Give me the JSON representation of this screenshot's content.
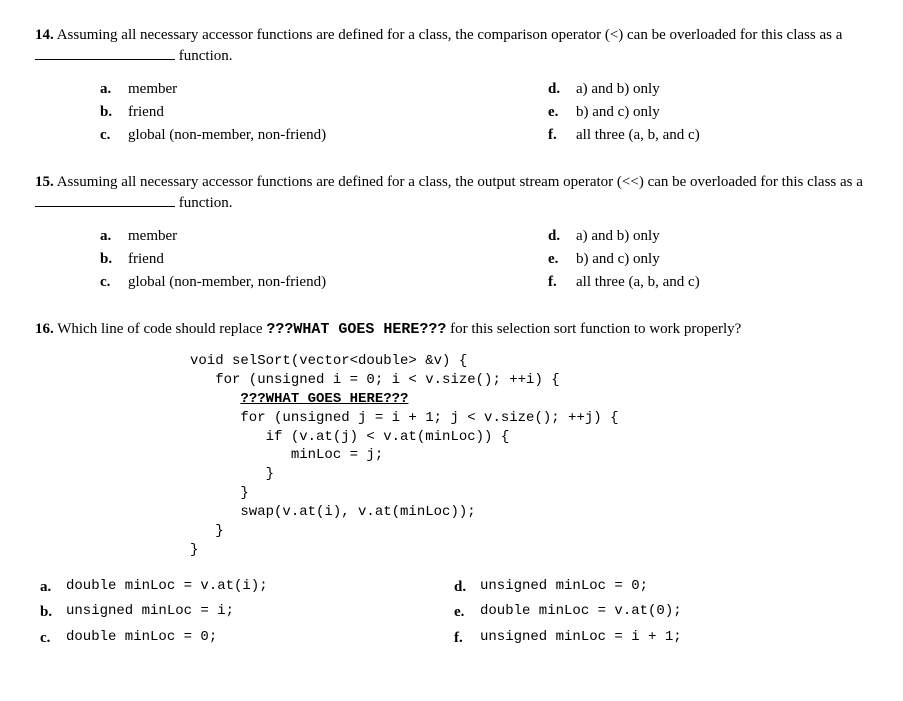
{
  "q14": {
    "number": "14.",
    "text_before": "Assuming all necessary accessor functions are defined for a class, the comparison operator (<) can be overloaded for this class as a ",
    "text_after": " function.",
    "options_left": [
      {
        "letter": "a.",
        "text": "member"
      },
      {
        "letter": "b.",
        "text": "friend"
      },
      {
        "letter": "c.",
        "text": "global (non-member, non-friend)"
      }
    ],
    "options_right": [
      {
        "letter": "d.",
        "text": "a) and b) only"
      },
      {
        "letter": "e.",
        "text": "b) and c) only"
      },
      {
        "letter": "f.",
        "text": "all three (a, b, and c)"
      }
    ]
  },
  "q15": {
    "number": "15.",
    "text_before": "Assuming all necessary accessor functions are defined for a class, the output stream operator (<<) can be overloaded for this class as a ",
    "text_after": " function.",
    "options_left": [
      {
        "letter": "a.",
        "text": "member"
      },
      {
        "letter": "b.",
        "text": "friend"
      },
      {
        "letter": "c.",
        "text": "global (non-member, non-friend)"
      }
    ],
    "options_right": [
      {
        "letter": "d.",
        "text": "a) and b) only"
      },
      {
        "letter": "e.",
        "text": "b) and c) only"
      },
      {
        "letter": "f.",
        "text": "all three (a, b, and c)"
      }
    ]
  },
  "q16": {
    "number": "16.",
    "text_before": "Which line of code should replace ",
    "placeholder": "???WHAT GOES HERE???",
    "text_after": " for this selection sort function to work properly?",
    "code_lines": [
      "void selSort(vector<double> &v) {",
      "   for (unsigned i = 0; i < v.size(); ++i) {",
      "      ",
      "      for (unsigned j = i + 1; j < v.size(); ++j) {",
      "         if (v.at(j) < v.at(minLoc)) {",
      "            minLoc = j;",
      "         }",
      "      }",
      "      swap(v.at(i), v.at(minLoc));",
      "   }",
      "}"
    ],
    "code_placeholder": "???WHAT GOES HERE???",
    "options_left": [
      {
        "letter": "a.",
        "text": "double minLoc = v.at(i);"
      },
      {
        "letter": "b.",
        "text": "unsigned minLoc = i;"
      },
      {
        "letter": "c.",
        "text": "double minLoc = 0;"
      }
    ],
    "options_right": [
      {
        "letter": "d.",
        "text": "unsigned minLoc = 0;"
      },
      {
        "letter": "e.",
        "text": "double minLoc = v.at(0);"
      },
      {
        "letter": "f.",
        "text": "unsigned minLoc = i + 1;"
      }
    ]
  }
}
